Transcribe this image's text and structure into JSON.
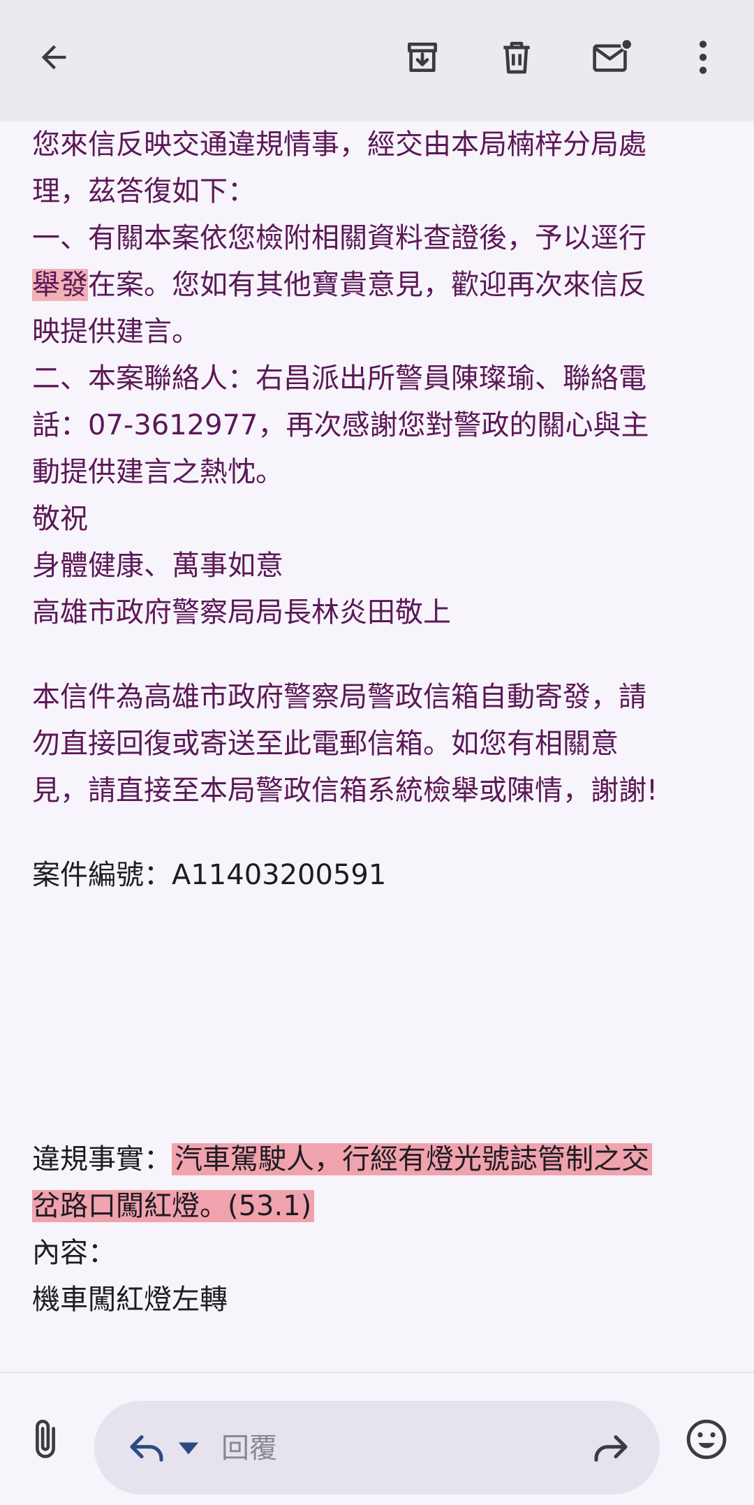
{
  "toolbar": {
    "back_icon": "arrow-left-icon",
    "archive_icon": "archive-icon",
    "delete_icon": "trash-icon",
    "mark_unread_icon": "mail-unread-icon",
    "more_icon": "more-vertical-icon"
  },
  "email": {
    "lines": [
      "您來信反映交通違規情事，經交由本局楠梓分局處",
      "理，茲答復如下：",
      "一、有關本案依您檢附相關資料查證後，予以逕行",
      "在案。您如有其他寶貴意見，歡迎再次來信反",
      "映提供建言。",
      "二、本案聯絡人：右昌派出所警員陳璨瑜、聯絡電",
      "話：07-3612977，再次感謝您對警政的關心與主",
      "動提供建言之熱忱。",
      "敬祝",
      "身體健康、萬事如意",
      "高雄市政府警察局局長林炎田敬上"
    ],
    "highlight_word": "舉發",
    "notice_lines": [
      "本信件為高雄市政府警察局警政信箱自動寄發，請",
      "勿直接回復或寄送至此電郵信箱。如您有相關意",
      "見，請直接至本局警政信箱系統檢舉或陳情，謝謝!"
    ],
    "case_number": "案件編號：A11403200591",
    "violation_label": "違規事實：",
    "violation_text_1": "汽車駕駛人，行經有燈光號誌管制之交",
    "violation_text_2": "岔路口闖紅燈。(53.1)",
    "content_label": "內容：",
    "content_text": "機車闖紅燈左轉"
  },
  "bottom_bar": {
    "attach_icon": "paperclip-icon",
    "reply_icon": "reply-icon",
    "reply_dropdown_icon": "caret-down-icon",
    "reply_placeholder": "回覆",
    "forward_icon": "forward-icon",
    "emoji_icon": "emoji-icon"
  },
  "colors": {
    "toolbar_bg": "#ece9ef",
    "page_bg": "#f7f4fb",
    "body_text": "#5b1857",
    "highlight": "#f0a3ad"
  }
}
